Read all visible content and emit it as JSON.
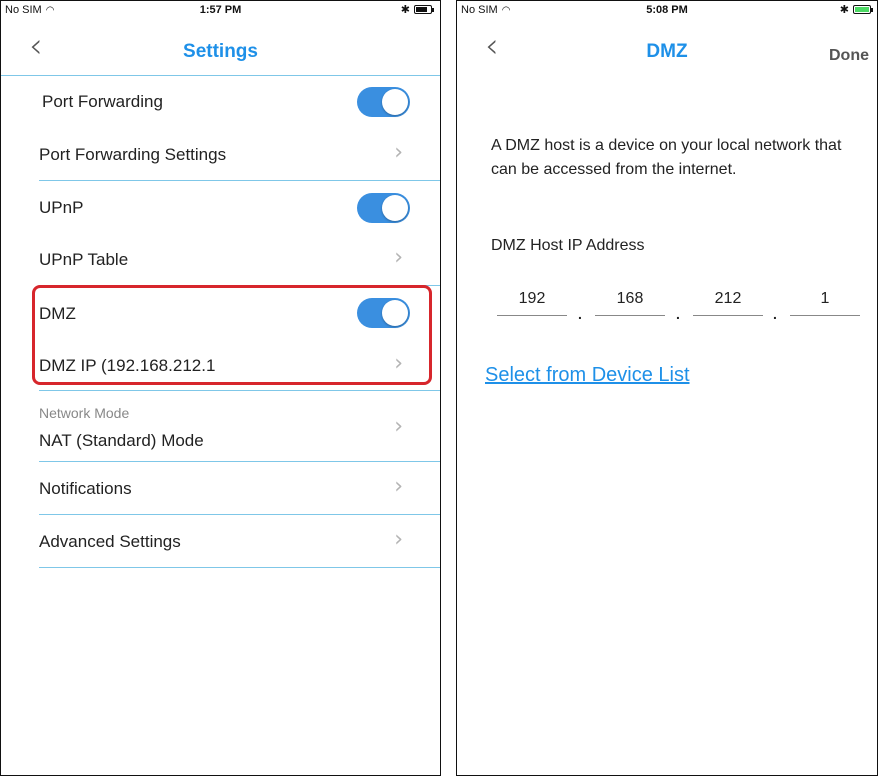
{
  "left_screen": {
    "status": {
      "carrier": "No SIM",
      "time": "1:57 PM"
    },
    "nav": {
      "back_glyph": "‹",
      "title": "Settings"
    },
    "rows": {
      "port_forwarding": "Port Forwarding",
      "port_forwarding_settings": "Port Forwarding Settings",
      "upnp": "UPnP",
      "upnp_table": "UPnP Table",
      "dmz": "DMZ",
      "dmz_ip": "DMZ IP (192.168.212.1",
      "network_mode_label": "Network Mode",
      "network_mode_value": "NAT (Standard) Mode",
      "notifications": "Notifications",
      "advanced_settings": "Advanced Settings"
    },
    "toggles": {
      "port_forwarding": true,
      "upnp": true,
      "dmz": true
    },
    "chevron_glyph": "›"
  },
  "right_screen": {
    "status": {
      "carrier": "No SIM",
      "time": "5:08 PM"
    },
    "nav": {
      "back_glyph": "‹",
      "title": "DMZ",
      "done": "Done"
    },
    "description": "A DMZ host is a device on your local network that can be accessed from the internet.",
    "ip_label": "DMZ Host IP Address",
    "ip_octets": [
      "192",
      "168",
      "212",
      "1"
    ],
    "link": "Select from Device List"
  },
  "colors": {
    "accent": "#1e90e8",
    "toggle_on": "#3a8fe0",
    "highlight": "#d7262c",
    "separator": "#7fc7e8"
  },
  "icons": [
    "wifi-icon",
    "bluetooth-icon",
    "battery-icon",
    "back-chevron-icon",
    "chevron-right-icon"
  ]
}
